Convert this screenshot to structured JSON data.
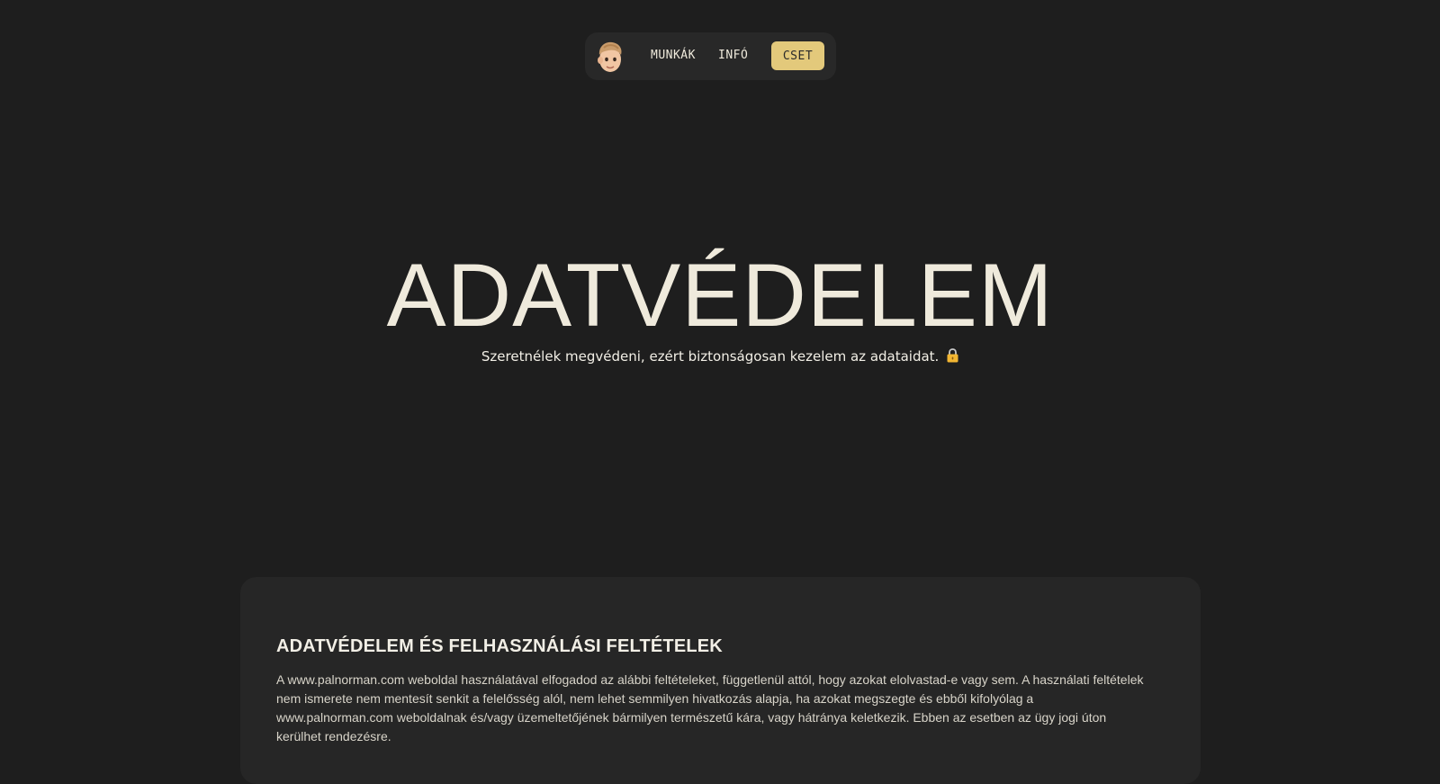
{
  "nav": {
    "avatar_icon": "memoji-avatar-icon",
    "links": [
      {
        "label": "MUNKÁK"
      },
      {
        "label": "INFÓ"
      }
    ],
    "cta_label": "CSET",
    "cta_color": "#e3c97b"
  },
  "hero": {
    "title": "ADATVÉDELEM",
    "subtitle": "Szeretnélek megvédeni, ezért biztonságosan kezelem az adataidat.",
    "subtitle_icon": "lock-icon"
  },
  "section": {
    "title": "ADATVÉDELEM ÉS FELHASZNÁLÁSI FELTÉTELEK",
    "body": "A www.palnorman.com weboldal használatával elfogadod az alábbi feltételeket, függetlenül attól, hogy azokat elolvastad-e vagy sem. A használati feltételek nem ismerete nem mentesít senkit a felelősség alól, nem lehet semmilyen hivatkozás alapja, ha azokat megszegte és ebből kifolyólag a www.palnorman.com weboldalnak és/vagy üzemeltetőjének bármilyen természetű kára, vagy hátránya keletkezik. Ebben az esetben az ügy jogi úton kerülhet rendezésre."
  },
  "colors": {
    "background": "#1e1e1e",
    "nav_background": "#282828",
    "card_background": "#262626",
    "text": "#efeadc"
  }
}
